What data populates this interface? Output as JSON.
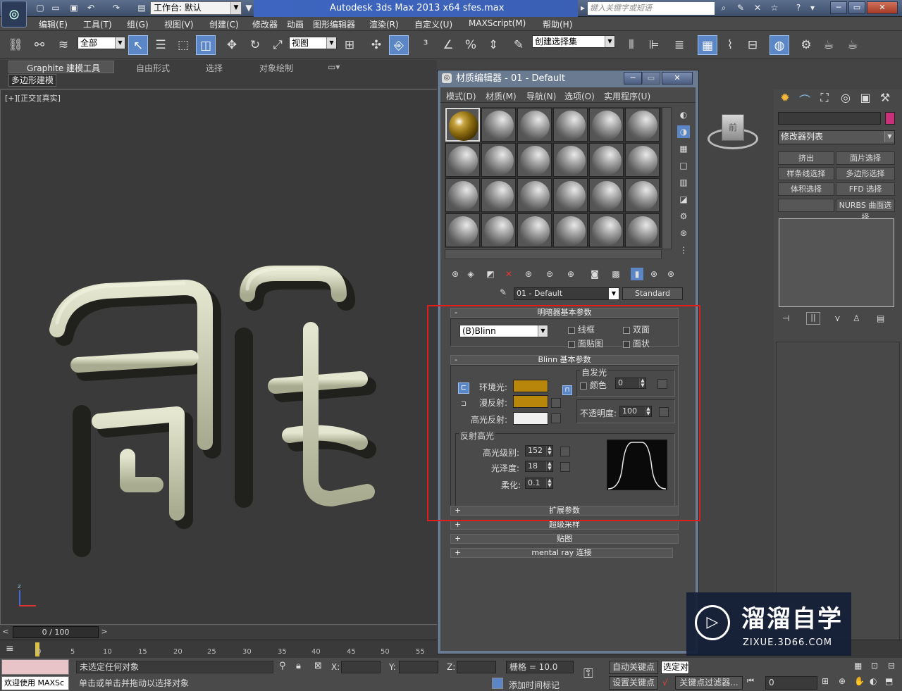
{
  "titlebar": {
    "workspace": "工作台: 默认",
    "app_title": "Autodesk 3ds Max  2013 x64      sfes.max",
    "search_placeholder": "键入关键字或短语"
  },
  "menu": [
    "编辑(E)",
    "工具(T)",
    "组(G)",
    "视图(V)",
    "创建(C)",
    "修改器",
    "动画",
    "图形编辑器",
    "渲染(R)",
    "自定义(U)",
    "MAXScript(M)",
    "帮助(H)"
  ],
  "toolbar": {
    "filter": "全部",
    "ref_coord": "视图",
    "named_selection": "创建选择集"
  },
  "ribbon": {
    "tabs": [
      "Graphite 建模工具",
      "自由形式",
      "选择",
      "对象绘制"
    ],
    "sub": "多边形建模"
  },
  "viewport": {
    "label": "[+][正交][真实]"
  },
  "timeline": {
    "frame": "0 / 100",
    "ticks": [
      "0",
      "5",
      "10",
      "15",
      "20",
      "25",
      "30",
      "35",
      "40",
      "45",
      "50",
      "55"
    ]
  },
  "status": {
    "welcome": "欢迎使用 MAXSc",
    "selection": "未选定任何对象",
    "prompt": "单击或单击并拖动以选择对象",
    "x": "X:",
    "y": "Y:",
    "z": "Z:",
    "grid": "栅格 = 10.0",
    "add_time_tag": "添加时间标记",
    "auto_key": "自动关键点",
    "selected": "选定对",
    "set_key": "设置关键点",
    "key_filters": "关键点过滤器...",
    "frame_field": "0"
  },
  "command_panel": {
    "modifier_list": "修改器列表",
    "buttons": [
      "挤出",
      "面片选择",
      "样条线选择",
      "多边形选择",
      "体积选择",
      "FFD 选择",
      "",
      "NURBS 曲面选择"
    ]
  },
  "material_editor": {
    "title": "材质编辑器 - 01 - Default",
    "menu": [
      "模式(D)",
      "材质(M)",
      "导航(N)",
      "选项(O)",
      "实用程序(U)"
    ],
    "material_name": "01 - Default",
    "material_type": "Standard",
    "shader_rollout": {
      "title": "明暗器基本参数",
      "shader": "(B)Blinn",
      "wire": "线框",
      "two_sided": "双面",
      "face_map": "面贴图",
      "faceted": "面状"
    },
    "blinn_rollout": {
      "title": "Blinn 基本参数",
      "self_illum": "自发光",
      "color_label": "颜色",
      "color_value": "0",
      "ambient": "环境光:",
      "diffuse": "漫反射:",
      "specular": "高光反射:",
      "opacity_label": "不透明度:",
      "opacity_value": "100",
      "spec_highlights": "反射高光",
      "spec_level_label": "高光级别:",
      "spec_level": "152",
      "glossiness_label": "光泽度:",
      "glossiness": "18",
      "soften_label": "柔化:",
      "soften": "0.1"
    },
    "collapsed_rollouts": [
      "扩展参数",
      "超级采样",
      "贴图",
      "mental ray 连接"
    ],
    "colors": {
      "ambient": "#b8860b",
      "diffuse": "#b8860b",
      "specular": "#f0f0f0"
    }
  },
  "watermark": {
    "name": "溜溜自学",
    "url": "ZIXUE.3D66.COM"
  },
  "viewcube_label": "前"
}
